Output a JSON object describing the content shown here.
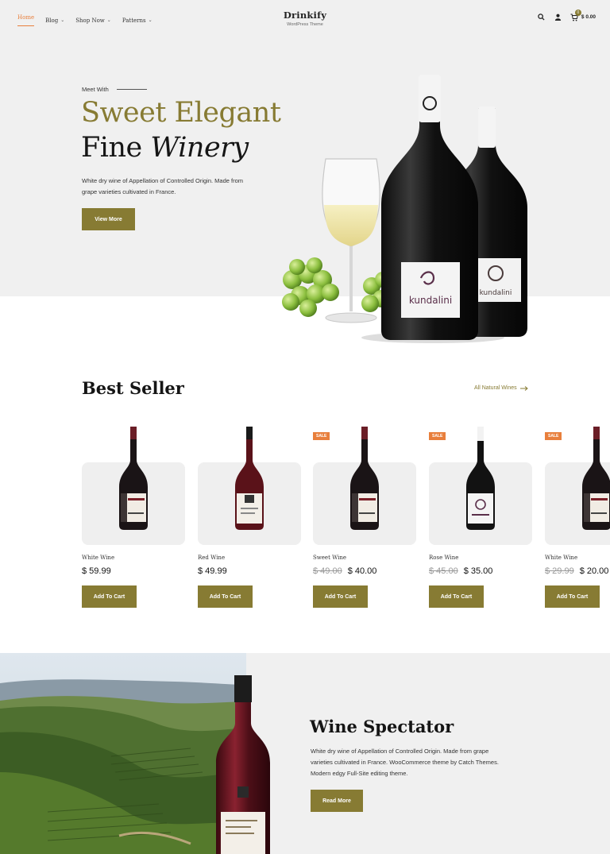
{
  "nav": {
    "items": [
      {
        "label": "Home"
      },
      {
        "label": "Blog"
      },
      {
        "label": "Shop Now"
      },
      {
        "label": "Patterns"
      }
    ]
  },
  "brand": {
    "title": "Drinkify",
    "subtitle": "WordPress Theme"
  },
  "cart": {
    "count": "0",
    "total": "$ 0.00"
  },
  "hero": {
    "eyebrow": "Meet With",
    "title_line1": "Sweet Elegant",
    "title_line2_plain": "Fine ",
    "title_line2_italic": "Winery",
    "description": "White dry wine of Appellation of Controlled Origin. Made from grape varieties cultivated in France.",
    "button": "View More",
    "label_brand": "kundalini"
  },
  "best_seller": {
    "title": "Best Seller",
    "link": "All Natural Wines",
    "products": [
      {
        "name": "White Wine",
        "price": "$ 59.99",
        "old_price": "",
        "sale": "",
        "button": "Add To Cart"
      },
      {
        "name": "Red Wine",
        "price": "$ 49.99",
        "old_price": "",
        "sale": "",
        "button": "Add To Cart"
      },
      {
        "name": "Sweet Wine",
        "price": "$ 40.00",
        "old_price": "$ 49.00",
        "sale": "SALE",
        "button": "Add To Cart"
      },
      {
        "name": "Rose Wine",
        "price": "$ 35.00",
        "old_price": "$ 45.00",
        "sale": "SALE",
        "button": "Add To Cart"
      },
      {
        "name": "White Wine",
        "price": "$ 20.00",
        "old_price": "$ 29.99",
        "sale": "SALE",
        "button": "Add To Cart"
      }
    ]
  },
  "feature": {
    "title": "Wine Spectator",
    "description": "White dry wine of Appellation of Controlled Origin. Made from grape varieties cultivated in France. WooCommerce theme by Catch Themes. Modern edgy Full-Site editing theme.",
    "button": "Read More"
  },
  "colors": {
    "accent": "#877b33",
    "sale": "#e87f3c",
    "active_nav": "#e87f3c",
    "hero_bg": "#f0f0f0"
  },
  "icons": [
    "search-icon",
    "user-icon",
    "cart-icon",
    "chevron-down-icon",
    "arrow-right-icon"
  ]
}
